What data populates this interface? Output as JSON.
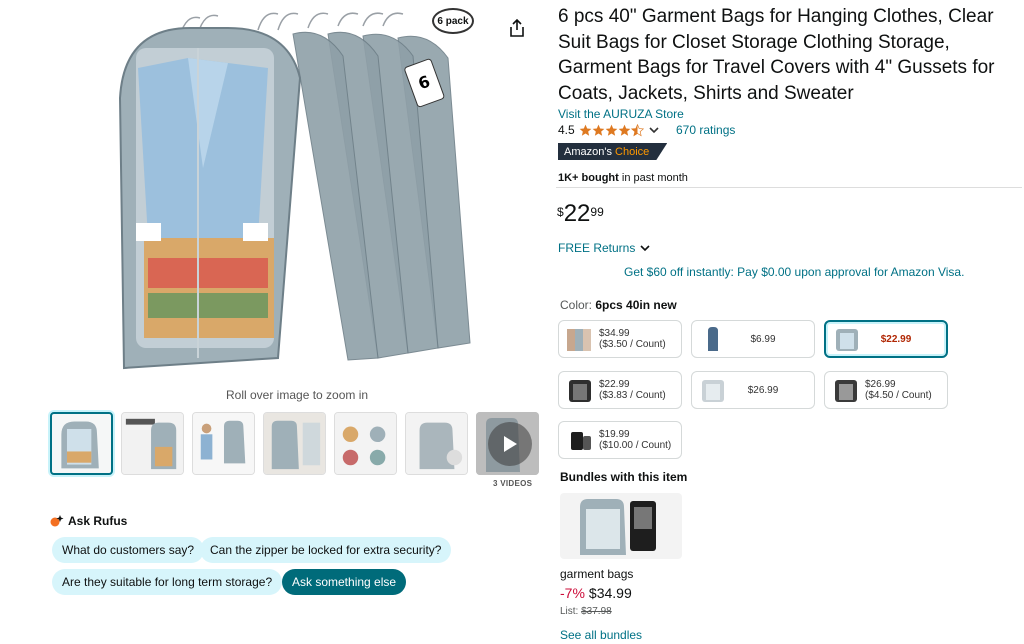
{
  "product": {
    "title": "6 pcs 40\" Garment Bags for Hanging Clothes, Clear Suit Bags for Closet Storage Clothing Storage, Garment Bags for Travel Covers with 4\" Gussets for Coats, Jackets, Shirts and Sweater",
    "store_link": "Visit the AURUZA Store",
    "rating": "4.5",
    "ratings_count": "670 ratings",
    "badge_prefix": "Amazon's",
    "badge_suffix": "Choice",
    "bought_bold": "1K+ bought",
    "bought_rest": " in past month",
    "price": {
      "symbol": "$",
      "whole": "22",
      "fraction": "99"
    },
    "returns": "FREE Returns",
    "visa_offer": "Get $60 off instantly: Pay $0.00 upon approval for Amazon Visa."
  },
  "gallery": {
    "pack_badge": "6 pack",
    "zoom_hint": "Roll over image to zoom in",
    "videos_label": "3 VIDEOS"
  },
  "rufus": {
    "title": "Ask Rufus",
    "chips": [
      "What do customers say?",
      "Can the zipper be locked for extra security?",
      "Are they suitable for long term storage?",
      "Ask something else"
    ]
  },
  "color": {
    "label": "Color:",
    "selected": "6pcs 40in new",
    "options": [
      {
        "line1": "$34.99",
        "line2": "($3.50 / Count)"
      },
      {
        "line1": "$6.99",
        "line2": ""
      },
      {
        "line1": "$22.99",
        "line2": ""
      },
      {
        "line1": "$22.99",
        "line2": "($3.83 / Count)"
      },
      {
        "line1": "$26.99",
        "line2": ""
      },
      {
        "line1": "$26.99",
        "line2": "($4.50 / Count)"
      },
      {
        "line1": "$19.99",
        "line2": "($10.00 / Count)"
      }
    ]
  },
  "bundles": {
    "title": "Bundles with this item",
    "name": "garment bags",
    "discount": "-7%",
    "price": "$34.99",
    "list_label": "List:",
    "list_price": "$37.98",
    "see_all": "See all bundles"
  },
  "colors": {
    "link": "#007185",
    "selected_border": "#007185",
    "badge_bg": "#232f3e",
    "badge_accent": "#ff9900",
    "price_red": "#b12704",
    "chip_bg": "#d7f5fb",
    "chip_dark": "#006b7a",
    "star": "#de7921"
  }
}
